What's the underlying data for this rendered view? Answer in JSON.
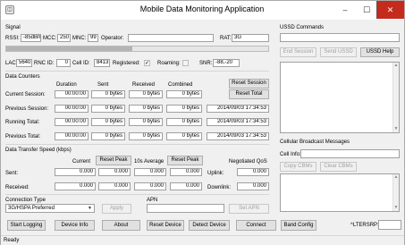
{
  "window": {
    "title": "Mobile Data Monitoring Application",
    "app_icon": "app-icon",
    "minimize_glyph": "–",
    "maximize_glyph": "☐",
    "close_glyph": "✕"
  },
  "signal": {
    "section_label": "Signal",
    "rssi_label": "RSSI:",
    "rssi_value": "-85dBm",
    "mcc_label": "MCC:",
    "mcc_value": "250",
    "mnc_label": "MNC:",
    "mnc_value": "99",
    "operator_label": "Operator:",
    "operator_value": "",
    "rat_label": "RAT:",
    "rat_value": "3G",
    "signal_strength_fraction": 0.48,
    "lac_label": "LAC:",
    "lac_value": "56401",
    "rnc_label": "RNC ID:",
    "rnc_value": "0",
    "cellid_label": "Cell ID:",
    "cellid_value": "8413",
    "registered_label": "Registered:",
    "registered_checked": true,
    "roaming_label": "Roaming:",
    "roaming_checked": false,
    "snr_label": "SNR:",
    "snr_value": "-88,-20",
    "check_glyph": "✓"
  },
  "counters": {
    "section_label": "Data Counters",
    "col_duration": "Duration",
    "col_sent": "Sent",
    "col_received": "Received",
    "col_combined": "Combined",
    "rows": [
      {
        "label": "Current Session:",
        "duration": "00:00:00",
        "sent": "0 bytes",
        "received": "0 bytes",
        "combined": "0 bytes",
        "extra": ""
      },
      {
        "label": "Previous Session:",
        "duration": "00:00:00",
        "sent": "0 bytes",
        "received": "0 bytes",
        "combined": "0 bytes",
        "extra": "2014/09/03 17:34:53"
      },
      {
        "label": "Running Total:",
        "duration": "00:00:00",
        "sent": "0 bytes",
        "received": "0 bytes",
        "combined": "0 bytes",
        "extra": "2014/09/03 17:34:53"
      },
      {
        "label": "Previous Total:",
        "duration": "00:00:00",
        "sent": "0 bytes",
        "received": "0 bytes",
        "combined": "0 bytes",
        "extra": "2014/09/03 17:34:53"
      }
    ],
    "reset_session": "Reset Session",
    "reset_total": "Reset Total"
  },
  "speed": {
    "section_label": "Data Transfer Speed (kbps)",
    "col_current": "Current",
    "reset_peak_1": "Reset Peak",
    "col_10s": "10s Average",
    "reset_peak_2": "Reset Peak",
    "col_qos": "Negotiated QoS",
    "sent_label": "Sent:",
    "received_label": "Received:",
    "sent_values": [
      "0.000",
      "0.000",
      "0.000",
      "0.000"
    ],
    "received_values": [
      "0.000",
      "0.000",
      "0.000",
      "0.000"
    ],
    "uplink_label": "Uplink:",
    "uplink_value": "0.000",
    "downlink_label": "Downlink:",
    "downlink_value": "0.000"
  },
  "connection": {
    "type_label": "Connection Type",
    "type_value": "3G/HSPA Preferred",
    "apply": "Apply",
    "apn_label": "APN",
    "apn_value": "",
    "set_apn": "Set APN"
  },
  "bottom_buttons": {
    "start_logging": "Start Logging",
    "device_info": "Device Info",
    "about": "About",
    "reset_device": "Reset Device",
    "detect_device": "Detect Device",
    "connect": "Connect",
    "band_config": "Band Config",
    "status_text": "^LTERSRP:"
  },
  "ussd": {
    "section_label": "USSD Commands",
    "input_value": "",
    "end_session": "End Session",
    "send_ussd": "Send USSD",
    "ussd_help": "USSD Help"
  },
  "cbm": {
    "section_label": "Cellular Broadcast Messages",
    "cell_info_label": "Cell Info:",
    "cell_info_value": "",
    "copy_cbms": "Copy CBMs",
    "clear_cbms": "Clear CBMs"
  },
  "status": {
    "text": "Ready"
  },
  "colors": {
    "close_button": "#c42b1c",
    "background": "#f0f0f0"
  }
}
